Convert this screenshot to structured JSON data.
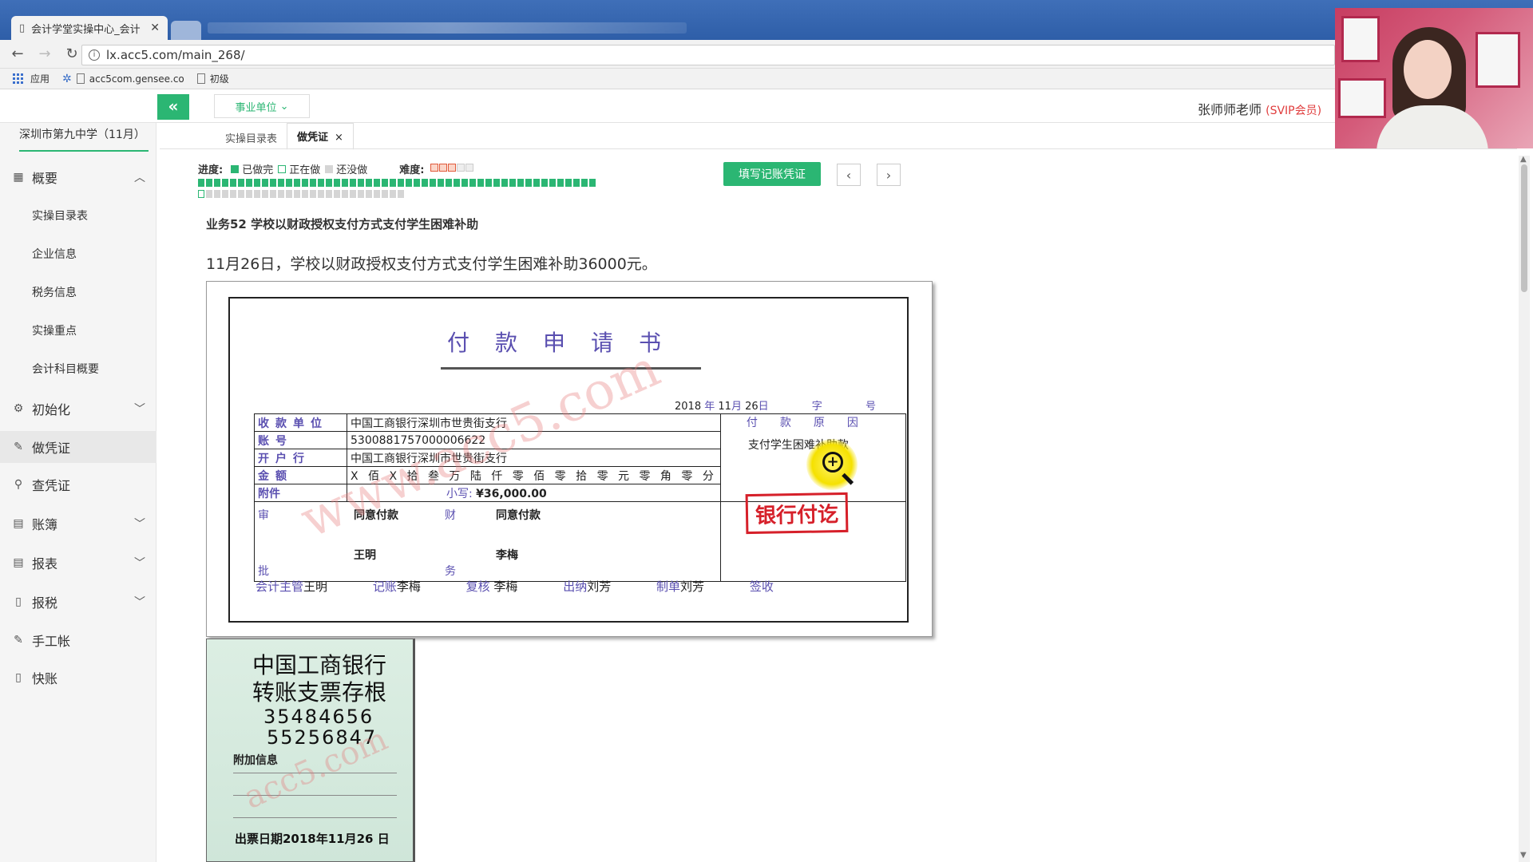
{
  "browser": {
    "tab_title": "会计学堂实操中心_会计",
    "url": "lx.acc5.com/main_268/",
    "bookmarks": [
      "应用",
      "acc5com.gensee.co",
      "初级"
    ]
  },
  "header": {
    "unit_select": "事业单位",
    "user_name": "张师师老师",
    "user_badge": "(SVIP会员)"
  },
  "sidebar": {
    "school": "深圳市第九中学（11月）",
    "groups": [
      {
        "label": "概要",
        "icon": "overview-icon",
        "expanded": true,
        "children": [
          "实操目录表",
          "企业信息",
          "税务信息",
          "实操重点",
          "会计科目概要"
        ]
      },
      {
        "label": "初始化",
        "icon": "gear-icon"
      },
      {
        "label": "做凭证",
        "icon": "pen-icon",
        "active": true
      },
      {
        "label": "查凭证",
        "icon": "search-icon"
      },
      {
        "label": "账簿",
        "icon": "book-icon"
      },
      {
        "label": "报表",
        "icon": "report-icon"
      },
      {
        "label": "报税",
        "icon": "tax-doc-icon"
      },
      {
        "label": "手工帐",
        "icon": "pen-icon"
      },
      {
        "label": "快账",
        "icon": "doc-icon"
      }
    ]
  },
  "content_tabs": [
    {
      "label": "实操目录表"
    },
    {
      "label": "做凭证",
      "active": true
    }
  ],
  "progress": {
    "label": "进度:",
    "done": "已做完",
    "doing": "正在做",
    "todo": "还没做",
    "difficulty_label": "难度:",
    "difficulty_level": 3,
    "difficulty_max": 5,
    "completed_count": 50,
    "remaining_count": 26
  },
  "actions": {
    "fill_voucher": "填写记账凭证",
    "prev": "‹",
    "next": "›"
  },
  "business": {
    "title": "业务52 学校以财政授权支付方式支付学生困难补助",
    "description": "11月26日，学校以财政授权支付方式支付学生困难补助36000元。"
  },
  "payment_form": {
    "title": "付款申请书",
    "date": {
      "year": "2018",
      "year_unit": "年",
      "month": "11",
      "month_unit": "月",
      "day": "26",
      "day_unit": "日",
      "zi": "字",
      "hao": "号"
    },
    "payee_label": "收款单位",
    "payee": "中国工商银行深圳市世贵街支行",
    "account_label": "账号",
    "account": "5300881757000006622",
    "bank_label": "开户行",
    "bank": "中国工商银行深圳市世贵街支行",
    "amount_label": "金额",
    "amount_upper": "X 佰 X 拾 叁 万 陆 仟 零 佰 零 拾 零 元 零 角 零 分",
    "attach_label": "附件",
    "small_label": "小写:",
    "small_amount": "¥36,000.00",
    "reason_label": "付款原因",
    "reason": "支付学生困难补助款",
    "approve_chars": [
      "审",
      "批"
    ],
    "finance_chars": [
      "财",
      "务"
    ],
    "approve_note": "同意付款",
    "approver": "王明",
    "finance_note": "同意付款",
    "finance_person": "李梅",
    "footer": [
      {
        "label": "会计主管",
        "name": "王明"
      },
      {
        "label": "记账",
        "name": "李梅"
      },
      {
        "label": "复核",
        "name": "李梅"
      },
      {
        "label": "出纳",
        "name": "刘芳"
      },
      {
        "label": "制单",
        "name": "刘芳"
      },
      {
        "label": "签收",
        "name": ""
      }
    ],
    "stamp": "银行付讫",
    "watermark": "www.acc5.com"
  },
  "cheque_stub": {
    "line1": "中国工商银行",
    "line2": "转账支票存根",
    "num1": "35484656",
    "num2": "55256847",
    "extra_label": "附加信息",
    "date_label": "出票日期2018年11月26 日",
    "watermark": "acc5.com"
  }
}
